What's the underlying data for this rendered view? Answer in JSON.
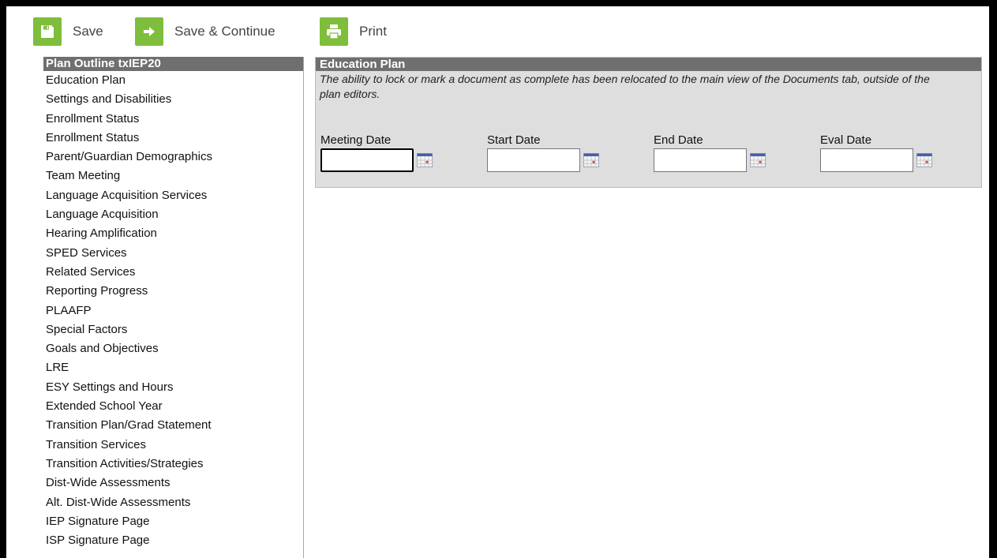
{
  "toolbar": {
    "save_label": "Save",
    "save_continue_label": "Save & Continue",
    "print_label": "Print",
    "accent_color": "#7ebe3c"
  },
  "outline": {
    "title": "Plan Outline txIEP20",
    "items": [
      "Education Plan",
      "Settings and Disabilities",
      "Enrollment Status",
      "Enrollment Status",
      "Parent/Guardian Demographics",
      "Team Meeting",
      "Language Acquisition Services",
      "Language Acquisition",
      "Hearing Amplification",
      "SPED Services",
      "Related Services",
      "Reporting Progress",
      "PLAAFP",
      "Special Factors",
      "Goals and Objectives",
      "LRE",
      "ESY Settings and Hours",
      "Extended School Year",
      "Transition Plan/Grad Statement",
      "Transition Services",
      "Transition Activities/Strategies",
      "Dist-Wide Assessments",
      "Alt. Dist-Wide Assessments",
      "IEP Signature Page",
      "ISP Signature Page"
    ]
  },
  "editor": {
    "title": "Education Plan",
    "note": "The ability to lock or mark a document as complete has been relocated to the main view of the Documents tab, outside of the plan editors.",
    "fields": {
      "meeting_date": {
        "label": "Meeting Date",
        "value": ""
      },
      "start_date": {
        "label": "Start Date",
        "value": ""
      },
      "end_date": {
        "label": "End Date",
        "value": ""
      },
      "eval_date": {
        "label": "Eval Date",
        "value": ""
      }
    }
  },
  "icons": {
    "save": "floppy-disk-icon",
    "save_continue": "arrow-right-icon",
    "print": "printer-icon",
    "calendar": "calendar-icon"
  }
}
